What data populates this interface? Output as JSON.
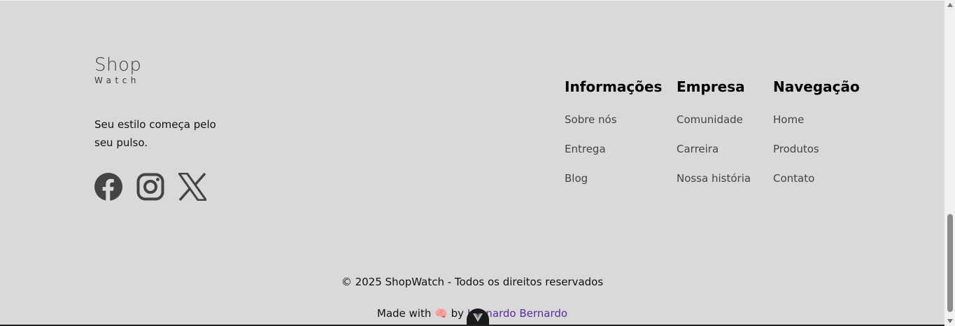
{
  "brand": {
    "name": "Shop",
    "sub": "Watch"
  },
  "tagline": "Seu estilo começa pelo seu pulso.",
  "socials": [
    {
      "icon": "facebook-icon"
    },
    {
      "icon": "instagram-icon"
    },
    {
      "icon": "x-twitter-icon"
    }
  ],
  "columns": {
    "info": {
      "title": "Informações",
      "links": [
        "Sobre nós",
        "Entrega",
        "Blog"
      ]
    },
    "empresa": {
      "title": "Empresa",
      "links": [
        "Comunidade",
        "Carreira",
        "Nossa história"
      ]
    },
    "nav": {
      "title": "Navegação",
      "links": [
        "Home",
        "Produtos",
        "Contato"
      ]
    }
  },
  "footer": {
    "copyright": "© 2025 ShopWatch - Todos os direitos reservados",
    "made_with": "Made with",
    "emoji": "🧠",
    "by": "by",
    "author": "Leonardo Bernardo"
  },
  "colors": {
    "background": "#d9d9d9",
    "icon": "#444444",
    "author_link": "#5b2b9e"
  }
}
